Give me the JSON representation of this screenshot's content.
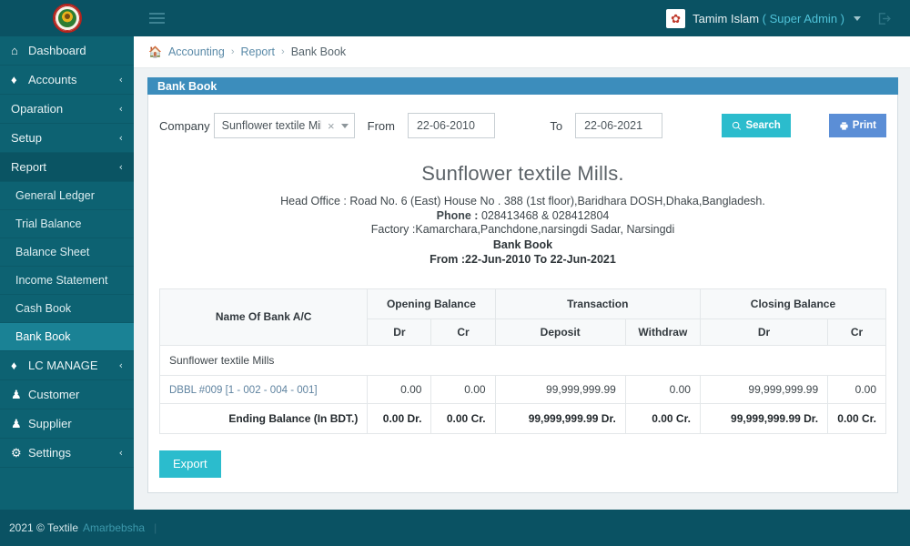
{
  "topbar": {
    "logo_name": "company-logo",
    "menu_icon": "hamburger-icon",
    "user_name": "Tamim Islam ",
    "user_role": "( Super Admin )",
    "logout_icon": "logout-icon"
  },
  "sidebar": {
    "items": [
      {
        "label": "Dashboard",
        "icon": "home-icon",
        "icon_glyph": "⌂",
        "arrow": "",
        "type": "item"
      },
      {
        "label": "Accounts",
        "icon": "diamond-icon",
        "icon_glyph": "♦",
        "arrow": "‹",
        "type": "item"
      },
      {
        "label": "Oparation",
        "icon": "",
        "icon_glyph": "",
        "arrow": "‹",
        "type": "item"
      },
      {
        "label": "Setup",
        "icon": "",
        "icon_glyph": "",
        "arrow": "‹",
        "type": "item"
      },
      {
        "label": "Report",
        "icon": "",
        "icon_glyph": "",
        "arrow": "‹",
        "type": "item-active"
      },
      {
        "label": "General Ledger",
        "type": "sub"
      },
      {
        "label": "Trial Balance",
        "type": "sub"
      },
      {
        "label": "Balance Sheet",
        "type": "sub"
      },
      {
        "label": "Income Statement",
        "type": "sub"
      },
      {
        "label": "Cash Book",
        "type": "sub"
      },
      {
        "label": "Bank Book",
        "type": "sub-selected"
      },
      {
        "label": "LC MANAGE",
        "icon": "diamond-icon",
        "icon_glyph": "♦",
        "arrow": "‹",
        "type": "item"
      },
      {
        "label": "Customer",
        "icon": "user-icon",
        "icon_glyph": "♟",
        "arrow": "",
        "type": "item"
      },
      {
        "label": "Supplier",
        "icon": "user-icon",
        "icon_glyph": "♟",
        "arrow": "",
        "type": "item"
      },
      {
        "label": "Settings",
        "icon": "gear-icon",
        "icon_glyph": "⚙",
        "arrow": "‹",
        "type": "item"
      }
    ]
  },
  "breadcrumb": {
    "home_icon": "home-icon",
    "item1": "Accounting",
    "sep": "›",
    "item2": "Report",
    "current": "Bank Book"
  },
  "panel": {
    "title": "Bank Book"
  },
  "form": {
    "company_label": "Company",
    "company_value": "Sunflower textile Mills",
    "clear_icon": "clear-icon",
    "clear_glyph": "×",
    "from_label": "From",
    "from_value": "22-06-2010",
    "to_label": "To",
    "to_value": "22-06-2021",
    "search_label": "Search",
    "search_icon": "search-icon",
    "print_label": "Print",
    "print_icon": "printer-icon"
  },
  "report": {
    "title": "Sunflower textile Mills.",
    "head_office": "Head Office : Road No. 6 (East) House No . 388 (1st floor),Baridhara DOSH,Dhaka,Bangladesh.",
    "phone_label": "Phone :",
    "phone_value": " 028413468 & 028412804",
    "factory": "Factory :Kamarchara,Panchdone,narsingdi Sadar, Narsingdi",
    "report_name": "Bank Book",
    "date_range": "From :22-Jun-2010 To 22-Jun-2021"
  },
  "table": {
    "headers_top": [
      "Name Of Bank A/C",
      "Opening Balance",
      "Transaction",
      "Closing Balance"
    ],
    "headers_sub": [
      "Dr",
      "Cr",
      "Deposit",
      "Withdraw",
      "Dr",
      "Cr"
    ],
    "group_row": "Sunflower textile Mills",
    "rows": [
      {
        "account": "DBBL #009 [1 - 002 - 004 - 001]",
        "opening_dr": "0.00",
        "opening_cr": "0.00",
        "deposit": "99,999,999.99",
        "withdraw": "0.00",
        "closing_dr": "99,999,999.99",
        "closing_cr": "0.00"
      }
    ],
    "total": {
      "label": "Ending Balance (In BDT.)",
      "opening_dr": "0.00  Dr.",
      "opening_cr": "0.00  Cr.",
      "deposit": "99,999,999.99  Dr.",
      "withdraw": "0.00  Cr.",
      "closing_dr": "99,999,999.99  Dr.",
      "closing_cr": "0.00  Cr."
    }
  },
  "actions": {
    "export_label": "Export"
  },
  "footer": {
    "copyright": "2021 © Textile",
    "brand": "Amarbebsha",
    "bar": "|"
  },
  "colors": {
    "sidebar": "#0d6272",
    "topbar": "#0a5263",
    "panel_header": "#3c8dbc",
    "search_button": "#2bbccd",
    "print_button": "#5b8ed6",
    "selected_nav": "#1a8295"
  }
}
